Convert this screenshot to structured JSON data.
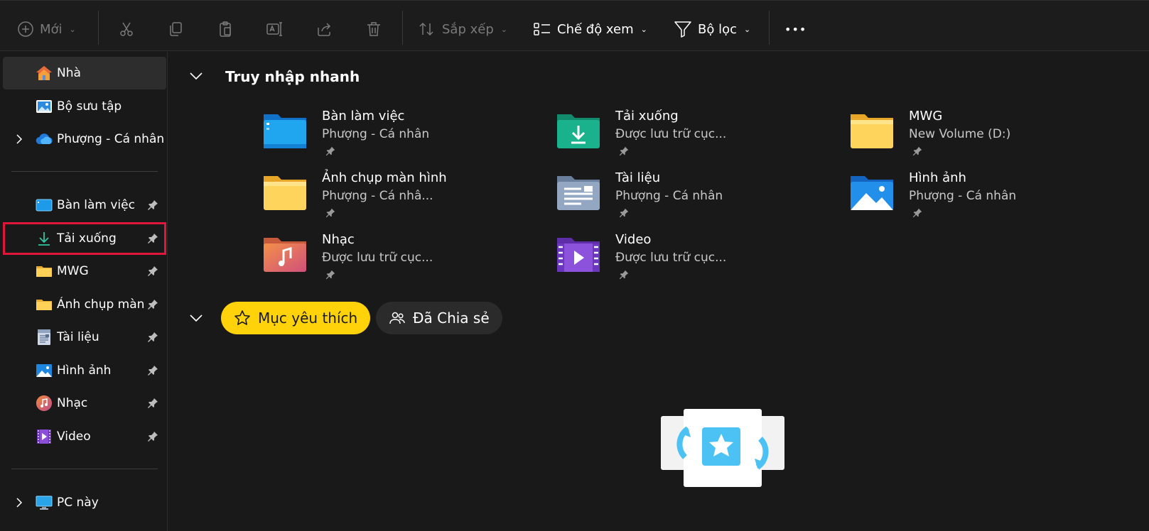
{
  "toolbar": {
    "new_label": "Mới",
    "sort_label": "Sắp xếp",
    "view_label": "Chế độ xem",
    "filter_label": "Bộ lọc",
    "more_label": "•••",
    "icons": [
      "add-circle-icon",
      "cut-icon",
      "copy-icon",
      "paste-icon",
      "rename-icon",
      "share-icon",
      "delete-icon",
      "sort-icon",
      "view-icon",
      "filter-icon",
      "more-icon"
    ]
  },
  "sidebar": {
    "items": [
      {
        "label": "Nhà",
        "icon": "home-icon"
      },
      {
        "label": "Bộ sưu tập",
        "icon": "gallery-icon"
      },
      {
        "label": "Phượng - Cá nhân",
        "icon": "onedrive-cloud-icon"
      },
      {
        "label": "Bàn làm việc",
        "icon": "desktop-icon"
      },
      {
        "label": "Tải xuống",
        "icon": "download-icon"
      },
      {
        "label": "MWG",
        "icon": "folder-icon"
      },
      {
        "label": "Ảnh chụp màn hình",
        "icon": "folder-icon"
      },
      {
        "label": "Tài liệu",
        "icon": "documents-icon"
      },
      {
        "label": "Hình ảnh",
        "icon": "pictures-icon"
      },
      {
        "label": "Nhạc",
        "icon": "music-icon"
      },
      {
        "label": "Video",
        "icon": "video-icon"
      },
      {
        "label": "PC này",
        "icon": "pc-icon"
      }
    ]
  },
  "quick_access": {
    "title": "Truy nhập nhanh",
    "items": [
      {
        "name": "Bàn làm việc",
        "sub": "Phượng - Cá nhân",
        "icon": "desktop-folder-icon"
      },
      {
        "name": "Tải xuống",
        "sub": "Được lưu trữ cục...",
        "icon": "downloads-folder-icon"
      },
      {
        "name": "MWG",
        "sub": "New Volume (D:)",
        "icon": "yellow-folder-icon"
      },
      {
        "name": "Ảnh chụp màn hình",
        "sub": "Phượng - Cá nhâ...",
        "icon": "yellow-folder-icon"
      },
      {
        "name": "Tài liệu",
        "sub": "Phượng - Cá nhân",
        "icon": "documents-folder-icon"
      },
      {
        "name": "Hình ảnh",
        "sub": "Phượng - Cá nhân",
        "icon": "pictures-folder-icon"
      },
      {
        "name": "Nhạc",
        "sub": "Được lưu trữ cục...",
        "icon": "music-folder-icon"
      },
      {
        "name": "Video",
        "sub": "Được lưu trữ cục...",
        "icon": "video-folder-icon"
      }
    ]
  },
  "tabs": {
    "favorites_label": "Mục yêu thích",
    "shared_label": "Đã Chia sẻ"
  },
  "colors": {
    "background": "#191919",
    "accent_yellow": "#ffd20a",
    "highlight_red": "#e0173b",
    "selected": "#2d2d2d"
  }
}
